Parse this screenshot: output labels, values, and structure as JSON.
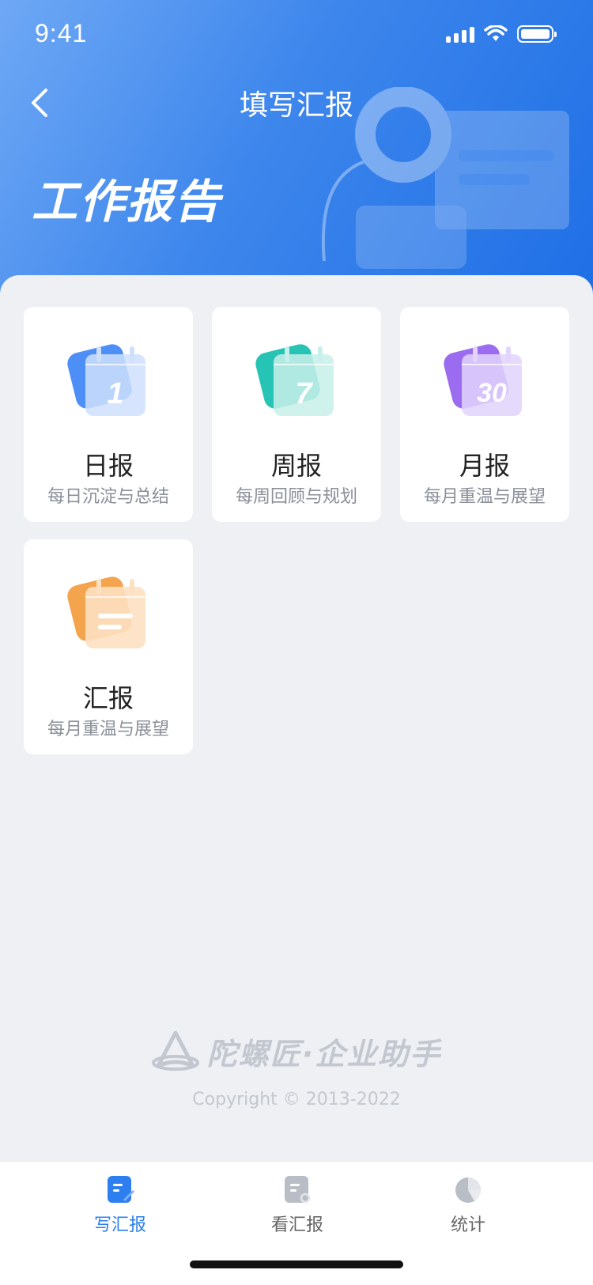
{
  "status_bar": {
    "time": "9:41"
  },
  "nav": {
    "title": "填写汇报"
  },
  "hero": {
    "title": "工作报告"
  },
  "cards": [
    {
      "title": "日报",
      "desc": "每日沉淀与总结",
      "icon": "calendar-1-icon",
      "icon_label": "1",
      "color": "#4e8ef7"
    },
    {
      "title": "周报",
      "desc": "每周回顾与规划",
      "icon": "calendar-7-icon",
      "icon_label": "7",
      "color": "#27c4b5"
    },
    {
      "title": "月报",
      "desc": "每月重温与展望",
      "icon": "calendar-30-icon",
      "icon_label": "30",
      "color": "#9b6cf0"
    },
    {
      "title": "汇报",
      "desc": "每月重温与展望",
      "icon": "report-icon",
      "icon_label": "",
      "color": "#f3a44d"
    }
  ],
  "footer": {
    "brand": "陀螺匠·企业助手",
    "copyright": "Copyright © 2013-2022"
  },
  "tabbar": {
    "tabs": [
      {
        "label": "写汇报",
        "icon": "write-report-icon",
        "active": true
      },
      {
        "label": "看汇报",
        "icon": "view-report-icon",
        "active": false
      },
      {
        "label": "统计",
        "icon": "stats-pie-icon",
        "active": false
      }
    ]
  },
  "colors": {
    "accent": "#2d7ff0",
    "header_start": "#6ea8f5",
    "header_end": "#1f6fe6"
  }
}
